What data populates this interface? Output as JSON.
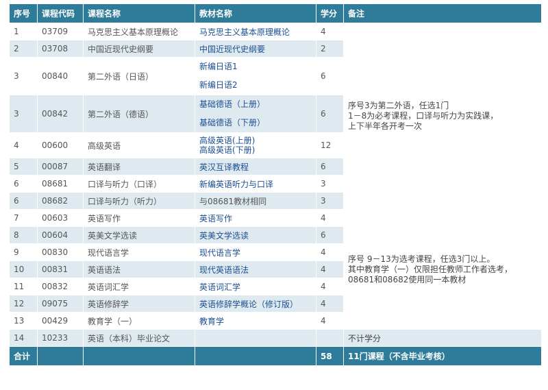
{
  "headers": [
    "序号",
    "课程代码",
    "课程名称",
    "教材名称",
    "学分",
    "备注"
  ],
  "rows": [
    {
      "no": "1",
      "code": "03709",
      "name": "马克思主义基本原理概论",
      "books": [
        "马克思主义基本原理概论"
      ],
      "credit": "4"
    },
    {
      "no": "2",
      "code": "03708",
      "name": "中国近现代史纲要",
      "books": [
        "中国近现代史纲要"
      ],
      "credit": "2"
    },
    {
      "no": "3",
      "code": "00840",
      "name": "第二外语（日语）",
      "books": [
        "新编日语1",
        "新编日语2"
      ],
      "credit": "6"
    },
    {
      "no": "3",
      "code": "00842",
      "name": "第二外语（德语）",
      "books": [
        "基础德语（上册）",
        "基础德语（下册）"
      ],
      "credit": "6"
    },
    {
      "no": "4",
      "code": "00600",
      "name": "高级英语",
      "books": [
        "高级英语(上册)",
        "高级英语(下册)"
      ],
      "credit": "12"
    },
    {
      "no": "5",
      "code": "00087",
      "name": "英语翻译",
      "books": [
        "英汉互译教程"
      ],
      "credit": "6"
    },
    {
      "no": "6",
      "code": "08681",
      "name": "口译与听力（口译）",
      "books": [
        "新编英语听力与口译"
      ],
      "credit": "3"
    },
    {
      "no": "6",
      "code": "08682",
      "name": "口译与听力（听力）",
      "books": [
        "与08681教材相同"
      ],
      "credit": "3"
    },
    {
      "no": "7",
      "code": "00603",
      "name": "英语写作",
      "books": [
        "英语写作"
      ],
      "credit": "4"
    },
    {
      "no": "8",
      "code": "00604",
      "name": "英美文学选读",
      "books": [
        "英美文学选读"
      ],
      "credit": "6"
    },
    {
      "no": "9",
      "code": "00830",
      "name": "现代语言学",
      "books": [
        "现代语言学"
      ],
      "credit": "4"
    },
    {
      "no": "10",
      "code": "00831",
      "name": "英语语法",
      "books": [
        "现代英语语法"
      ],
      "credit": "4"
    },
    {
      "no": "11",
      "code": "00832",
      "name": "英语词汇学",
      "books": [
        "英语词汇学"
      ],
      "credit": "4"
    },
    {
      "no": "12",
      "code": "09075",
      "name": "英语修辞学",
      "books": [
        "英语修辞学概论（修订版）"
      ],
      "credit": "4"
    },
    {
      "no": "13",
      "code": "00429",
      "name": "教育学（一）",
      "books": [
        "教育学"
      ],
      "credit": "4"
    },
    {
      "no": "14",
      "code": "10233",
      "name": "英语（本科）毕业论文",
      "books": [
        ""
      ],
      "credit": ""
    }
  ],
  "notes": {
    "group1": [
      "序号3为第二外语，任选1门",
      "1－8为必考课程，口译与听力为实践课，",
      "上下半年各开考一次"
    ],
    "group2": [
      "序号 9－13为选考课程，任选3门以上。",
      "其中教育学（一）仅限担任教师工作者选考，",
      "08681和08682使用同一本教材"
    ],
    "row14": "不计学分"
  },
  "footer": {
    "label": "合计",
    "credit": "58",
    "note": "11门课程（不含毕业考核）"
  },
  "colors": {
    "header_bg": "#2f7b9a",
    "stripe_bg": "#dfeaf0",
    "book_text": "#1a4e92"
  }
}
